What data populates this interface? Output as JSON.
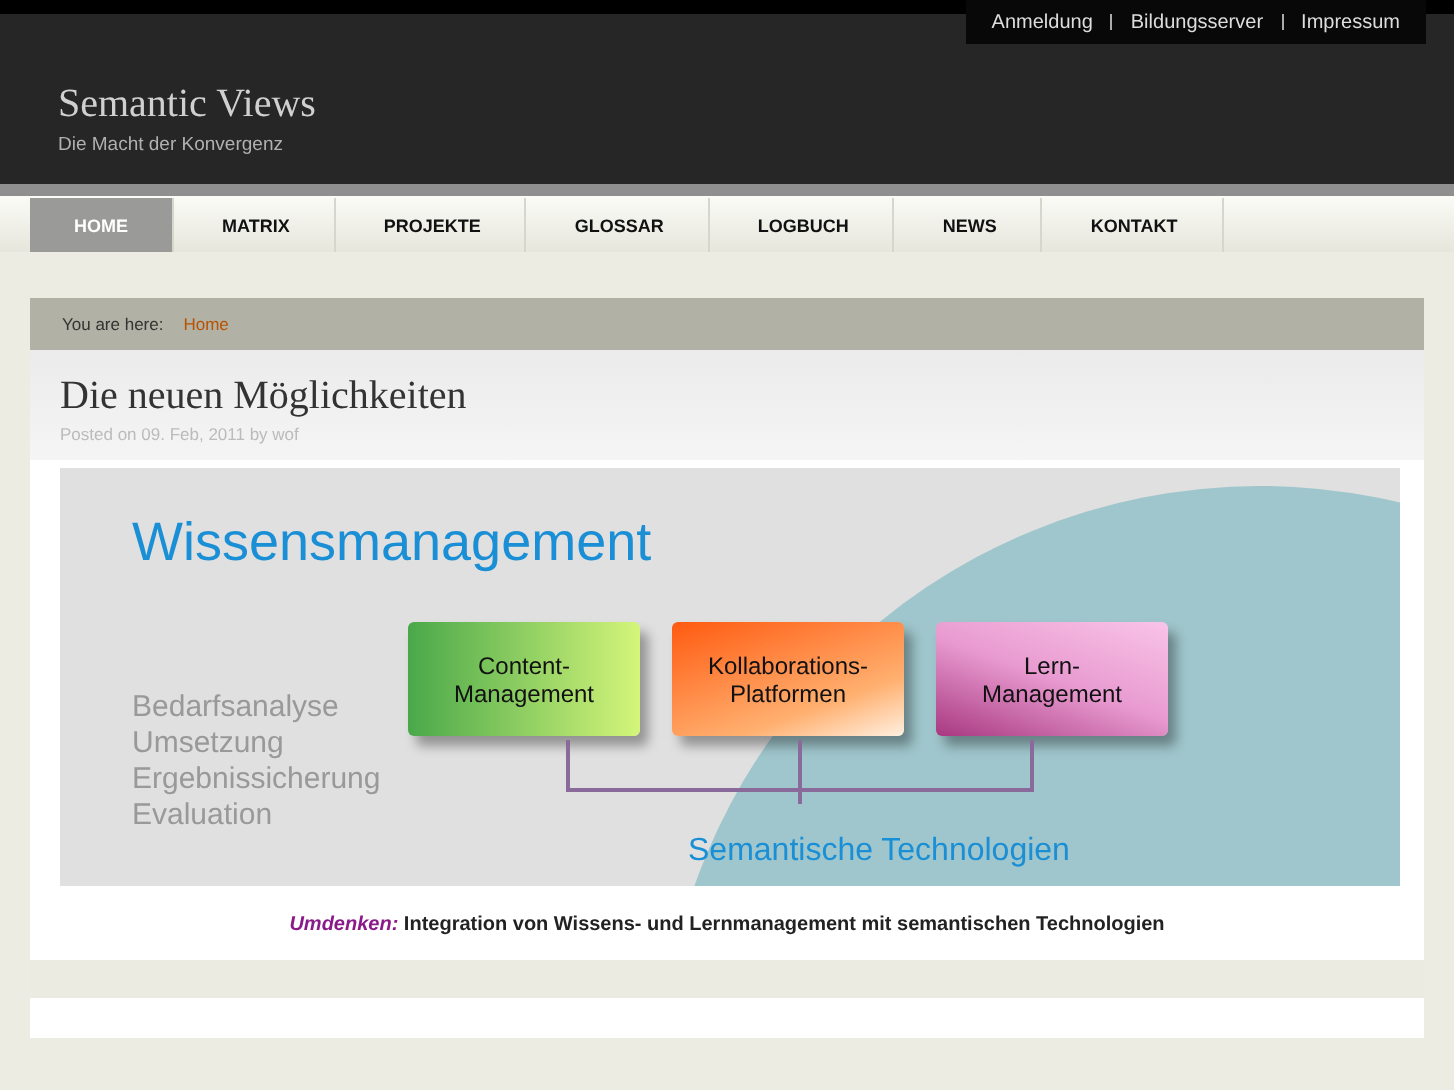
{
  "top_links": [
    "Anmeldung",
    "Bildungsserver",
    "Impressum"
  ],
  "site": {
    "title": "Semantic Views",
    "tagline": "Die Macht der Konvergenz"
  },
  "nav": [
    {
      "label": "HOME",
      "selected": true
    },
    {
      "label": "MATRIX",
      "selected": false
    },
    {
      "label": "PROJEKTE",
      "selected": false
    },
    {
      "label": "GLOSSAR",
      "selected": false
    },
    {
      "label": "LOGBUCH",
      "selected": false
    },
    {
      "label": "NEWS",
      "selected": false
    },
    {
      "label": "KONTAKT",
      "selected": false
    }
  ],
  "breadcrumb": {
    "label": "You are here:",
    "link": "Home"
  },
  "post": {
    "title": "Die neuen Möglichkeiten",
    "meta": "Posted on 09. Feb, 2011 by wof"
  },
  "diagram": {
    "title": "Wissensmanagement",
    "steps": [
      "Bedarfsanalyse",
      "Umsetzung",
      "Ergebnissicherung",
      "Evaluation"
    ],
    "boxes": [
      {
        "kind": "green",
        "lines": [
          "Content-",
          "Management"
        ]
      },
      {
        "kind": "orange",
        "lines": [
          "Kollaborations-",
          "Platformen"
        ]
      },
      {
        "kind": "pink",
        "lines": [
          "Lern-",
          "Management"
        ]
      }
    ],
    "base": "Semantische Technologien"
  },
  "caption": "*Umdenken:* Integration von Wissens- und Lernmanagement mit semantischen Technologien"
}
